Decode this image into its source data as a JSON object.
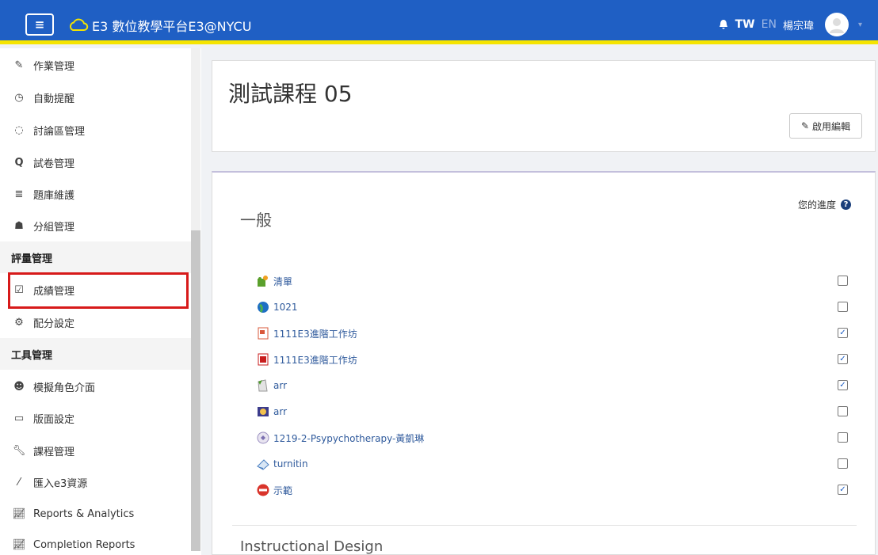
{
  "header": {
    "menu_icon": "hamburger-icon",
    "title": "E3 數位教學平台E3@NYCU",
    "lang_tw": "TW",
    "lang_en": "EN",
    "username": "楊宗瑋",
    "colors": {
      "bar": "#1f5fc4",
      "accent": "#f5e400"
    }
  },
  "sidebar": {
    "items": [
      {
        "label": "作業管理",
        "icon": "edit-icon"
      },
      {
        "label": "自動提醒",
        "icon": "clock-icon"
      },
      {
        "label": "討論區管理",
        "icon": "comment-icon"
      },
      {
        "label": "試卷管理",
        "icon": "quiz-icon"
      },
      {
        "label": "題庫維護",
        "icon": "database-icon"
      },
      {
        "label": "分組管理",
        "icon": "users-icon"
      }
    ],
    "heading_grading": "評量管理",
    "grading_items": [
      {
        "label": "成績管理",
        "icon": "checkbox-icon"
      },
      {
        "label": "配分設定",
        "icon": "cogs-icon"
      }
    ],
    "heading_tools": "工具管理",
    "tool_items": [
      {
        "label": "模擬角色介面",
        "icon": "reddit-icon"
      },
      {
        "label": "版面設定",
        "icon": "window-icon"
      },
      {
        "label": "課程管理",
        "icon": "wrench-icon"
      },
      {
        "label": "匯入e3資源",
        "icon": "magic-icon"
      },
      {
        "label": "Reports & Analytics",
        "icon": "chart-icon"
      },
      {
        "label": "Completion Reports",
        "icon": "chart-icon"
      }
    ]
  },
  "main": {
    "course_title": "測試課程 05",
    "edit_button": "啟用編輯",
    "progress_label": "您的進度",
    "section_title": "一般",
    "activities": [
      {
        "name": "清單",
        "icon": "puzzle-icon",
        "checked": false
      },
      {
        "name": "1021",
        "icon": "globe-icon",
        "checked": false
      },
      {
        "name": "1111E3進階工作坊",
        "icon": "powerpoint-icon",
        "checked": true
      },
      {
        "name": "1111E3進階工作坊",
        "icon": "pdf-icon",
        "checked": true
      },
      {
        "name": "arr",
        "icon": "file-icon",
        "checked": true
      },
      {
        "name": "arr",
        "icon": "media-icon",
        "checked": false
      },
      {
        "name": "1219-2-Psypychotherapy-黃凱琳",
        "icon": "scorm-icon",
        "checked": false
      },
      {
        "name": "turnitin",
        "icon": "turnitin-icon",
        "checked": false
      },
      {
        "name": "示範",
        "icon": "record-icon",
        "checked": true
      }
    ],
    "next_section_title": "Instructional Design"
  }
}
